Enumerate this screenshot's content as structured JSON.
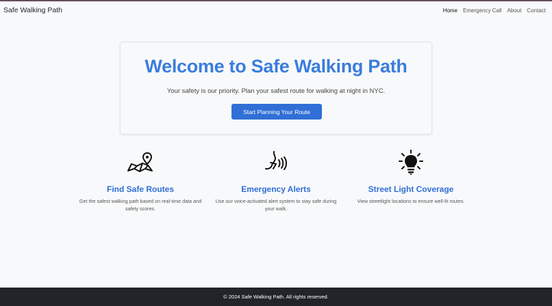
{
  "navbar": {
    "brand": "Safe Walking Path",
    "links": [
      "Home",
      "Emergency Call",
      "About",
      "Contact"
    ]
  },
  "hero": {
    "title": "Welcome to Safe Walking Path",
    "subtitle": "Your safety is our priority. Plan your safest route for walking at night in NYC.",
    "cta_label": "Start Planning Your Route"
  },
  "features": [
    {
      "icon": "map-pin-icon",
      "title": "Find Safe Routes",
      "description": "Get the safest walking path based on real-time data and safety scores."
    },
    {
      "icon": "voice-alert-icon",
      "title": "Emergency Alerts",
      "description": "Use our voice-activated alert system to stay safe during your walk."
    },
    {
      "icon": "light-bulb-icon",
      "title": "Street Light Coverage",
      "description": "View streetlight locations to ensure well-lit routes."
    }
  ],
  "footer": {
    "text": "© 2024 Safe Walking Path. All rights reserved."
  },
  "colors": {
    "accent": "#2f6fd6",
    "title": "#3b7ddd",
    "footer_bg": "#212529"
  }
}
